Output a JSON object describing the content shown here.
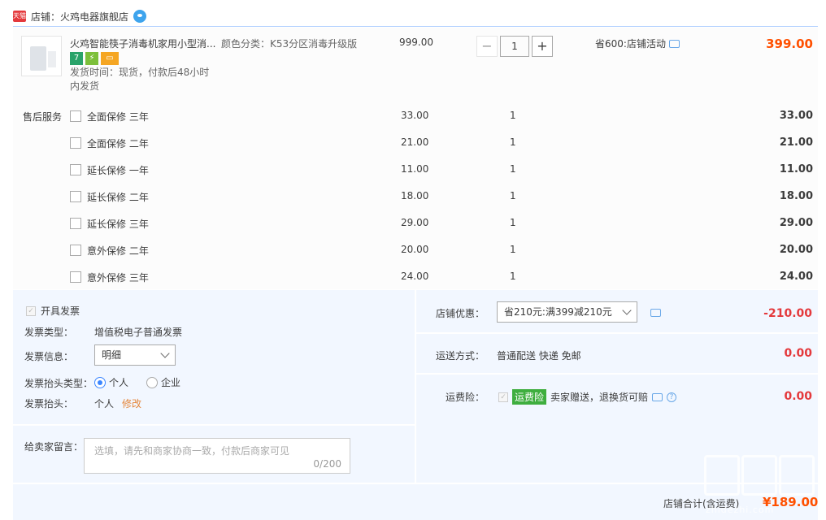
{
  "shop": {
    "badge": "天猫",
    "label": "店铺：火鸡电器旗舰店"
  },
  "item": {
    "title": "火鸡智能筷子消毒机家用小型消...",
    "sku": "颜色分类：K53分区消毒升级版",
    "price": "999.00",
    "quantity": "1",
    "promo": "省600:店铺活动",
    "subtotal": "399.00",
    "shipping_line1": "发货时间：现货，付款后48小时",
    "shipping_line2": "内发货",
    "icon7": "7"
  },
  "services": {
    "label": "售后服务",
    "rows": [
      {
        "name": "全面保修 三年",
        "price": "33.00",
        "qty": "1",
        "subtotal": "33.00"
      },
      {
        "name": "全面保修 二年",
        "price": "21.00",
        "qty": "1",
        "subtotal": "21.00"
      },
      {
        "name": "延长保修 一年",
        "price": "11.00",
        "qty": "1",
        "subtotal": "11.00"
      },
      {
        "name": "延长保修 二年",
        "price": "18.00",
        "qty": "1",
        "subtotal": "18.00"
      },
      {
        "name": "延长保修 三年",
        "price": "29.00",
        "qty": "1",
        "subtotal": "29.00"
      },
      {
        "name": "意外保修 二年",
        "price": "20.00",
        "qty": "1",
        "subtotal": "20.00"
      },
      {
        "name": "意外保修 三年",
        "price": "24.00",
        "qty": "1",
        "subtotal": "24.00"
      }
    ]
  },
  "invoice": {
    "open_label": "开具发票",
    "check_mark": "✓",
    "type_label": "发票类型：",
    "type_value": "增值税电子普通发票",
    "info_label": "发票信息：",
    "info_value": "明细",
    "header_type_label": "发票抬头类型：",
    "opt_personal": "个人",
    "opt_company": "企业",
    "header_label": "发票抬头：",
    "header_value": "个人",
    "edit_link": "修改"
  },
  "message": {
    "label": "给卖家留言：",
    "placeholder": "选填，请先和商家协商一致，付款后商家可见",
    "counter": "0/200"
  },
  "discount": {
    "label": "店铺优惠：",
    "selected": "省210元:满399减210元",
    "amount": "-210.00"
  },
  "delivery": {
    "label": "运送方式：",
    "value": "普通配送 快递 免邮",
    "amount": "0.00"
  },
  "freight_insurance": {
    "label": "运费险：",
    "check_mark": "✓",
    "tag": "运费险",
    "text": "卖家赠送，退换货可赔",
    "help": "?",
    "amount": "0.00"
  },
  "total": {
    "label": "店铺合计(含运费)",
    "value": "¥189.00"
  },
  "watermark": {
    "text": "zhidezhi.com"
  },
  "colors": {
    "accent": "#ff5000",
    "discount_red": "#e4393c",
    "panel_bg": "#f2f7ff",
    "divider": "#b2d1ff"
  }
}
